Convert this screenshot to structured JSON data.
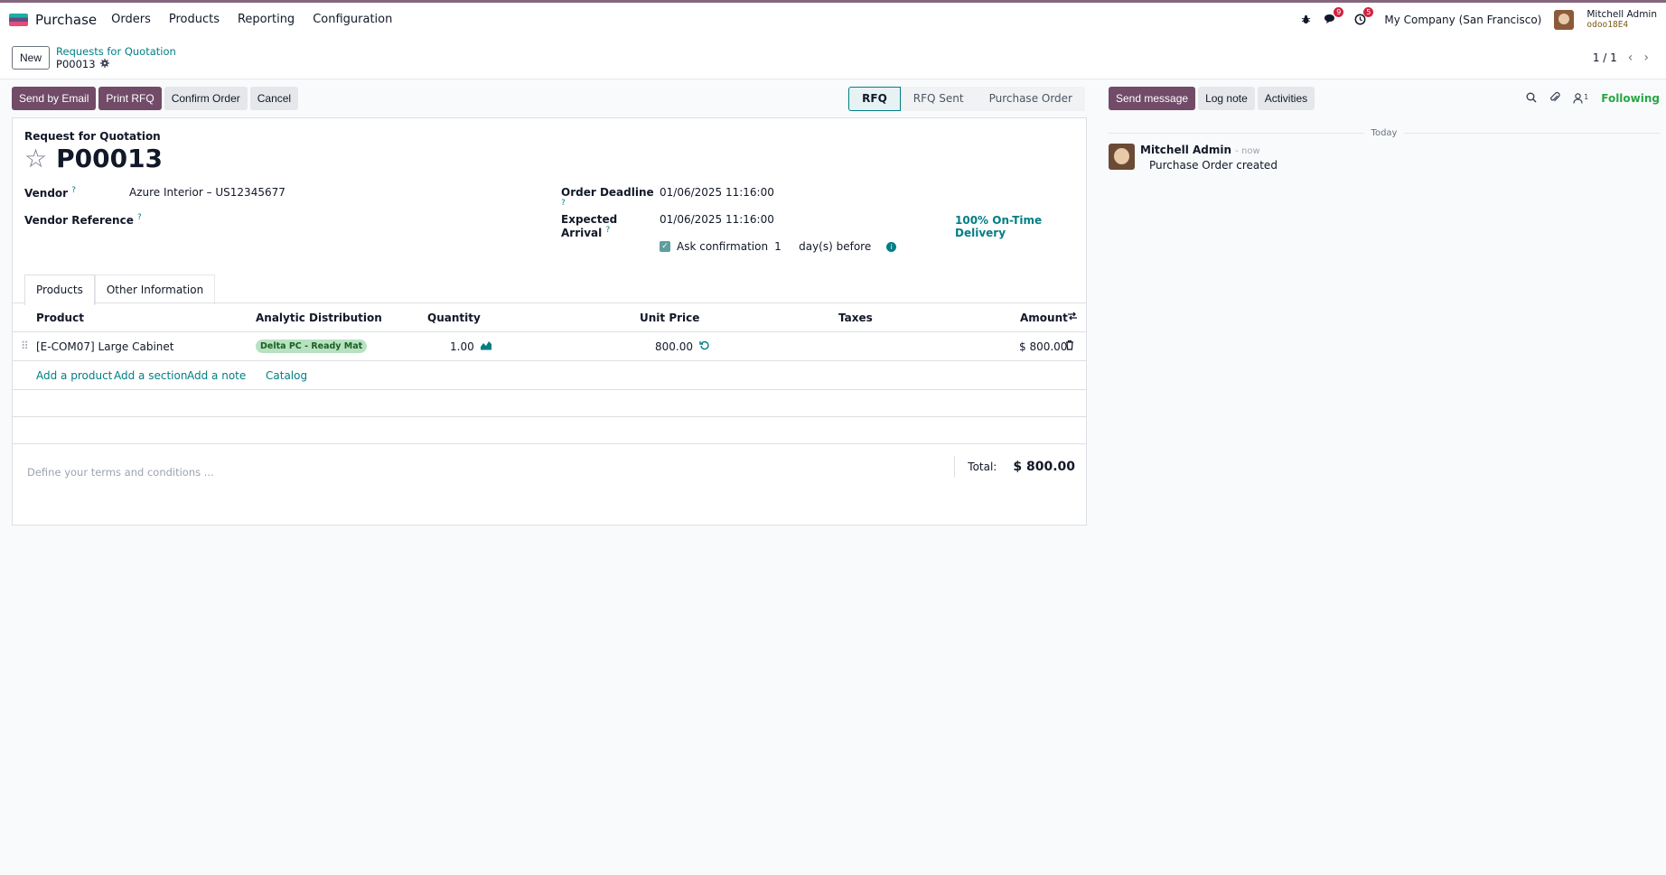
{
  "app": {
    "name": "Purchase"
  },
  "menu": [
    "Orders",
    "Products",
    "Reporting",
    "Configuration"
  ],
  "navbar": {
    "messages_badge": "9",
    "activities_badge": "5",
    "company": "My Company (San Francisco)",
    "user_name": "Mitchell Admin",
    "db_name": "odoo18E4"
  },
  "control": {
    "new_label": "New",
    "breadcrumb_parent": "Requests for Quotation",
    "breadcrumb_current": "P00013",
    "pager": "1 / 1"
  },
  "actions": {
    "send_email": "Send by Email",
    "print_rfq": "Print RFQ",
    "confirm": "Confirm Order",
    "cancel": "Cancel"
  },
  "statusbar": [
    "RFQ",
    "RFQ Sent",
    "Purchase Order"
  ],
  "form": {
    "subtitle": "Request for Quotation",
    "title": "P00013",
    "vendor_label": "Vendor",
    "vendor_value": "Azure Interior – US12345677",
    "vendor_ref_label": "Vendor Reference",
    "deadline_label": "Order Deadline",
    "deadline_value": "01/06/2025 11:16:00",
    "arrival_label": "Expected Arrival",
    "arrival_value": "01/06/2025 11:16:00",
    "ontime": "100% On-Time Delivery",
    "ask_label": "Ask confirmation",
    "ask_days": "1",
    "ask_suffix": "day(s) before",
    "tabs": [
      "Products",
      "Other Information"
    ],
    "table": {
      "headers": [
        "Product",
        "Analytic Distribution",
        "Quantity",
        "Unit Price",
        "Taxes",
        "Amount"
      ],
      "rows": [
        {
          "product": "[E-COM07] Large Cabinet",
          "analytic": "Delta PC - Ready Mat",
          "quantity": "1.00",
          "unit_price": "800.00",
          "taxes": "",
          "amount": "$ 800.00"
        }
      ],
      "add_links": [
        "Add a product",
        "Add a section",
        "Add a note",
        "Catalog"
      ]
    },
    "terms_placeholder": "Define your terms and conditions ...",
    "total_label": "Total:",
    "total_value": "$ 800.00"
  },
  "chatter": {
    "send_message": "Send message",
    "log_note": "Log note",
    "activities": "Activities",
    "followers_count": "1",
    "following": "Following",
    "date_separator": "Today",
    "message": {
      "author": "Mitchell Admin",
      "time": "- now",
      "body": "Purchase Order created"
    }
  }
}
